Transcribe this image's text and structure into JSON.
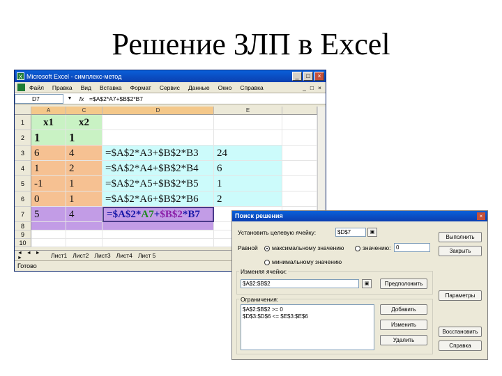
{
  "slide": {
    "title": "Решение ЗЛП в Excel"
  },
  "excel": {
    "window_title": "Microsoft Excel - симплекс-метод",
    "menu": [
      "Файл",
      "Правка",
      "Вид",
      "Вставка",
      "Формат",
      "Сервис",
      "Данные",
      "Окно",
      "Справка"
    ],
    "window_buttons": {
      "min": "_",
      "max": "□",
      "close": "×"
    },
    "name_box": "D7",
    "fx": "fx",
    "formula": "=$A$2*A7+$B$2*B7",
    "columns": [
      "A",
      "C",
      "D",
      "E"
    ],
    "rows": [
      {
        "num": "1",
        "a": "x1",
        "b": "x2",
        "c": "",
        "d": ""
      },
      {
        "num": "2",
        "a": "1",
        "b": "1",
        "c": "",
        "d": ""
      },
      {
        "num": "3",
        "a": "6",
        "b": "4",
        "c": "=$A$2*A3+$B$2*B3",
        "d": "24"
      },
      {
        "num": "4",
        "a": "1",
        "b": "2",
        "c": "=$A$2*A4+$B$2*B4",
        "d": "6"
      },
      {
        "num": "5",
        "a": "-1",
        "b": "1",
        "c": "=$A$2*A5+$B$2*B5",
        "d": "1"
      },
      {
        "num": "6",
        "a": "0",
        "b": "1",
        "c": "=$A$2*A6+$B$2*B6",
        "d": "2"
      },
      {
        "num": "7",
        "a": "5",
        "b": "4"
      }
    ],
    "row7_formula_parts": [
      "=",
      "$A$2",
      "*",
      "A7",
      "+",
      "$B$2",
      "*",
      "B7"
    ],
    "empty_rows": [
      "8",
      "9",
      "10"
    ],
    "sheet_tabs": [
      "Лист1",
      "Лист2",
      "Лист3",
      "Лист4",
      "Лист 5"
    ],
    "tab_nav": "◄ ◄ ► ►",
    "status": "Готово"
  },
  "solver": {
    "title": "Поиск решения",
    "close": "×",
    "target_label": "Установить целевую ячейку:",
    "target_value": "$D$7",
    "equal_label": "Равной",
    "opt_max": "максимальному значению",
    "opt_value": "значению:",
    "value_field": "0",
    "opt_min": "минимальному значению",
    "changing_label": "Изменяя ячейки:",
    "changing_value": "$A$2:$B$2",
    "guess_button": "Предположить",
    "constraints_label": "Ограничения:",
    "constraints": [
      "$A$2:$B$2 >= 0",
      "$D$3:$D$6 <= $E$3:$E$6"
    ],
    "buttons": {
      "run": "Выполнить",
      "close": "Закрыть",
      "params": "Параметры",
      "add": "Добавить",
      "change": "Изменить",
      "delete": "Удалить",
      "reset": "Восстановить",
      "help": "Справка"
    }
  }
}
